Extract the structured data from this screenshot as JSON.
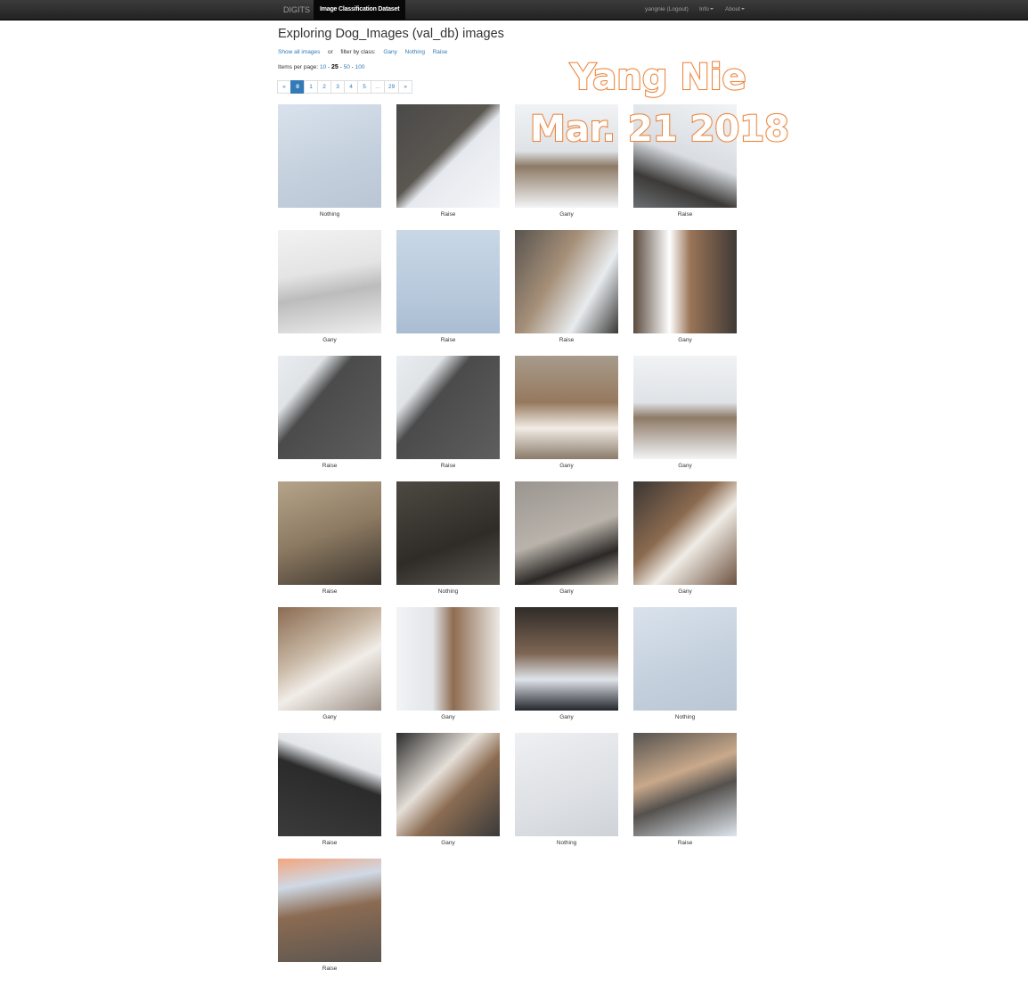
{
  "navbar": {
    "brand": "DIGITS",
    "active_tab": "Image Classification Dataset",
    "user": "yangnie (Logout)",
    "info": "Info",
    "about": "About"
  },
  "page_title": "Exploring Dog_Images (val_db) images",
  "filter": {
    "show_all": "Show all images",
    "or": "or",
    "filter_label": "filter by class:",
    "classes": [
      "Gany",
      "Nothing",
      "Raise"
    ]
  },
  "items_per_page": {
    "label": "Items per page:",
    "options": [
      "10",
      "25",
      "50",
      "100"
    ],
    "current": "25",
    "sep": "-"
  },
  "pagination": {
    "prev": "«",
    "pages": [
      "0",
      "1",
      "2",
      "3",
      "4",
      "5",
      "...",
      "29"
    ],
    "active": "0",
    "next": "»"
  },
  "images": [
    {
      "label": "Nothing",
      "thumb-icon": "snow-thumb"
    },
    {
      "label": "Raise",
      "thumb-icon": "dog-snow-road-thumb"
    },
    {
      "label": "Gany",
      "thumb-icon": "beagle-snow-thumb"
    },
    {
      "label": "Raise",
      "thumb-icon": "dog-snow-thumb"
    },
    {
      "label": "Gany",
      "thumb-icon": "dog-running-snow-thumb"
    },
    {
      "label": "Raise",
      "thumb-icon": "dog-in-snow-thumb"
    },
    {
      "label": "Raise",
      "thumb-icon": "dog-road-thumb"
    },
    {
      "label": "Gany",
      "thumb-icon": "beagle-closeup-thumb"
    },
    {
      "label": "Raise",
      "thumb-icon": "dog-on-road-thumb"
    },
    {
      "label": "Raise",
      "thumb-icon": "dog-on-road-thumb"
    },
    {
      "label": "Gany",
      "thumb-icon": "beagle-face-thumb"
    },
    {
      "label": "Gany",
      "thumb-icon": "beagle-snow-thumb"
    },
    {
      "label": "Raise",
      "thumb-icon": "dog-grass-thumb"
    },
    {
      "label": "Nothing",
      "thumb-icon": "ground-thumb"
    },
    {
      "label": "Gany",
      "thumb-icon": "beagle-shadow-thumb"
    },
    {
      "label": "Gany",
      "thumb-icon": "beagle-blur-thumb"
    },
    {
      "label": "Gany",
      "thumb-icon": "beagle-path-thumb"
    },
    {
      "label": "Gany",
      "thumb-icon": "beagle-snow-blur-thumb"
    },
    {
      "label": "Gany",
      "thumb-icon": "beagle-legs-thumb"
    },
    {
      "label": "Nothing",
      "thumb-icon": "snow-thumb"
    },
    {
      "label": "Raise",
      "thumb-icon": "dog-dark-road-thumb"
    },
    {
      "label": "Gany",
      "thumb-icon": "beagle-road-thumb"
    },
    {
      "label": "Nothing",
      "thumb-icon": "snow-light-thumb"
    },
    {
      "label": "Raise",
      "thumb-icon": "dog-snow-edge-thumb"
    },
    {
      "label": "Raise",
      "thumb-icon": "dog-sun-thumb"
    }
  ],
  "watermark": {
    "line1": "Yang Nie",
    "line2": "Mar. 21 2018",
    "color": "#e8782c"
  }
}
